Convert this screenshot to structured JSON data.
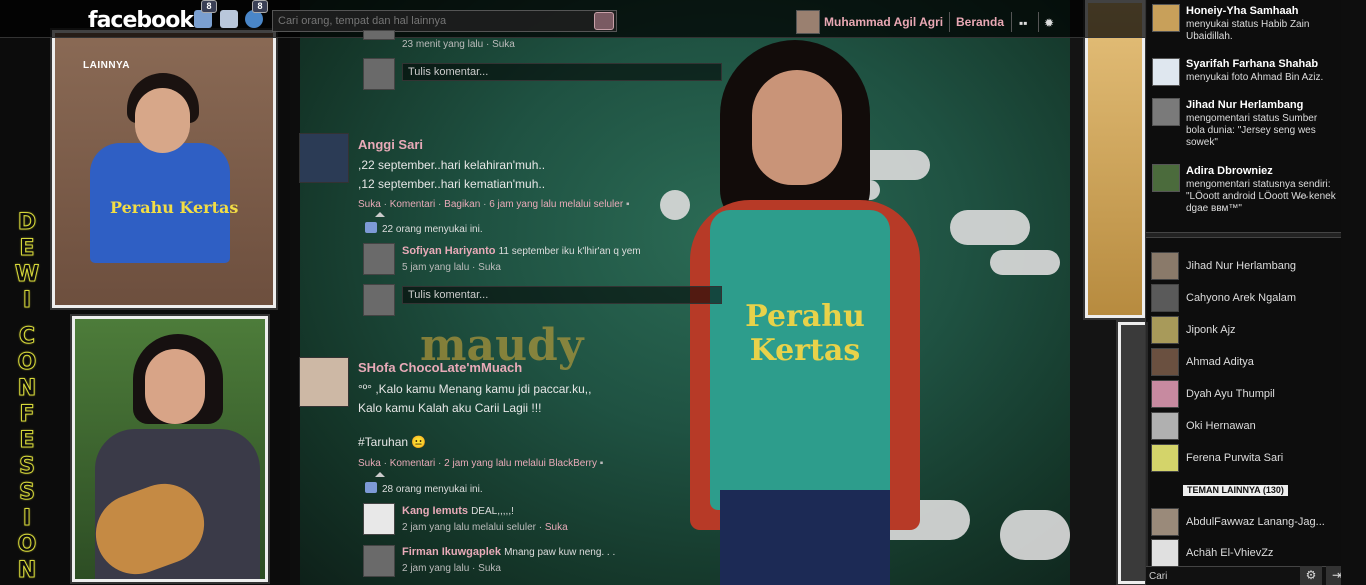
{
  "header": {
    "logo": "facebook",
    "friend_requests_badge": "8",
    "notifications_badge": "8",
    "search_placeholder": "Cari orang, tempat dan hal lainnya",
    "user_name": "Muhammad Agil Agri",
    "home_label": "Beranda",
    "icons": [
      "friends-icon",
      "messages-icon",
      "notifications-icon",
      "search-icon",
      "privacy-icon",
      "settings-icon"
    ]
  },
  "left_panel": {
    "lainnya_label": "LAINNYA",
    "vertical_title": [
      "D",
      "E",
      "W",
      "I",
      "",
      "C",
      "O",
      "N",
      "F",
      "E",
      "S",
      "S",
      "I",
      "O",
      "N"
    ]
  },
  "background": {
    "maudy_text": "maudy",
    "shirt_text": "Perahu\nKertas",
    "photo_shirt_text": "Perahu Kertas"
  },
  "feed": {
    "top_comment": {
      "time": "23 menit yang lalu",
      "like": "Suka",
      "comment_placeholder": "Tulis komentar..."
    },
    "post1": {
      "author": "Anggi Sari",
      "lines": [
        ",22 september..hari kelahiran'muh..",
        ",12 september..hari kematian'muh.."
      ],
      "actions": {
        "like": "Suka",
        "comment": "Komentari",
        "share": "Bagikan",
        "time": "6 jam yang lalu melalui seluler"
      },
      "likes": "22 orang menyukai ini.",
      "comment": {
        "author": "Sofiyan Hariyanto",
        "text": "11 september iku k'lhir'an q yem",
        "time": "5 jam yang lalu",
        "like": "Suka"
      },
      "comment_placeholder": "Tulis komentar..."
    },
    "post2": {
      "author": "SHofa ChocoLate'mMuach",
      "lines": [
        "°º° ,Kalo kamu Menang kamu jdi paccar.ku,,",
        "Kalo kamu Kalah aku Carii Lagii !!!",
        "",
        "#Taruhan 😐"
      ],
      "actions": {
        "like": "Suka",
        "comment": "Komentari",
        "time": "2 jam yang lalu melalui BlackBerry"
      },
      "likes": "28 orang menyukai ini.",
      "comments": [
        {
          "author": "Kang Iemuts",
          "text": "DEAL,,,,,!",
          "time": "2 jam yang lalu melalui seluler",
          "like": "Suka"
        },
        {
          "author": "Firman Ikuwgaplek",
          "text": "Mnang paw kuw neng. . .",
          "time": "2 jam yang lalu",
          "like": "Suka"
        }
      ]
    }
  },
  "sidebar": {
    "ticker": [
      {
        "name": "Honeiy-Yha Samhaah",
        "text": "menyukai status Habib Zain Ubaidillah."
      },
      {
        "name": "Syarifah Farhana Shahab",
        "text": "menyukai foto Ahmad Bin Aziz."
      },
      {
        "name": "Jihad Nur Herlambang",
        "text": "mengomentari status Sumber bola dunia: \"Jersey seng wes sowek\""
      },
      {
        "name": "Adira Dbrowniez",
        "text": "mengomentari statusnya sendiri: \"LÖoott android LÖoott W̴e̴ kenek dgae ввм™\""
      }
    ],
    "chat": [
      "Jihad Nur Herlambang",
      "Cahyono Arek Ngalam",
      "Jiponk Ajz",
      "Ahmad Aditya",
      "Dyah Ayu Thumpil",
      "Oki Hernawan",
      "Ferena Purwita Sari"
    ],
    "more_friends": "TEMAN LAINNYA (130)",
    "chat_more": [
      "AbdulFawwaz Lanang-Jag...",
      "Achäh El-VhievZz"
    ],
    "search_label": "Cari"
  },
  "colors": {
    "link_pink": "#e8aab8",
    "topbar": "#000000",
    "bg_green": "#1f5242",
    "title_yellow": "#d7d93a"
  }
}
